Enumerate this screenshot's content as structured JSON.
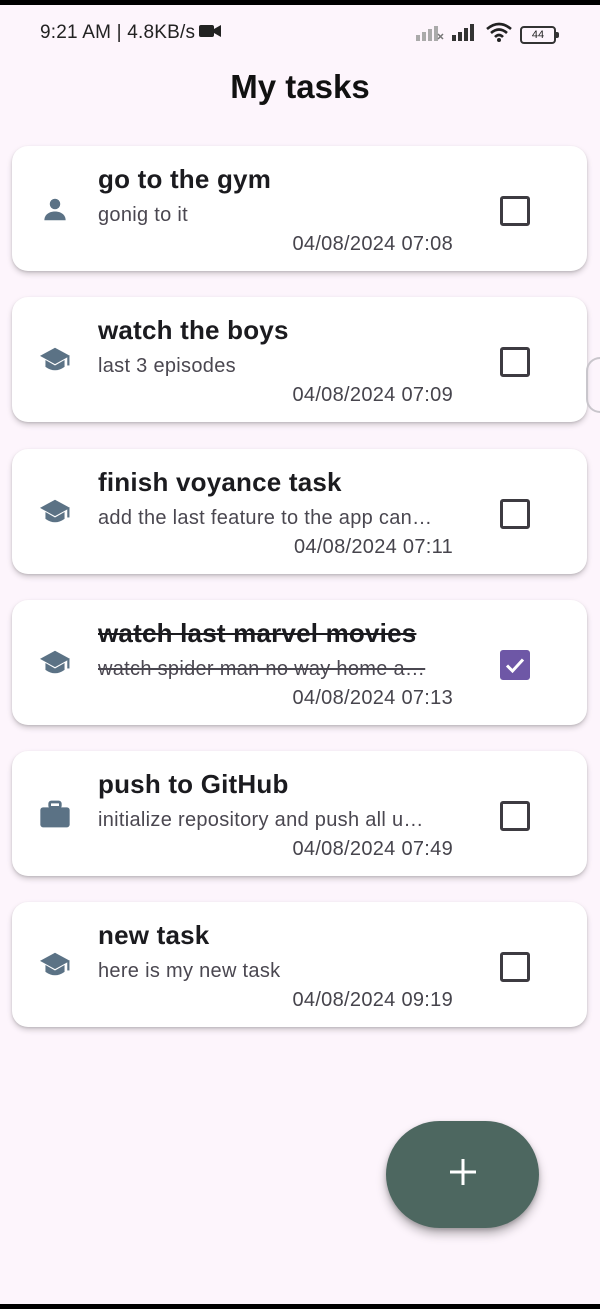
{
  "status_bar": {
    "time_and_speed": "9:21 AM | 4.8KB/s",
    "battery": "44"
  },
  "header": {
    "title": "My tasks"
  },
  "colors": {
    "background": "#fdf5fc",
    "icon": "#5b7285",
    "checkbox_checked": "#6e57a6",
    "fab": "#4d6760"
  },
  "tasks": [
    {
      "title": "go to the gym",
      "description": "gonig to it",
      "date": "04/08/2024 07:08",
      "icon": "person-icon",
      "done": false
    },
    {
      "title": "watch the boys",
      "description": "last 3 episodes",
      "date": "04/08/2024 07:09",
      "icon": "school-icon",
      "done": false
    },
    {
      "title": "finish voyance task",
      "description": "add the last feature to the app can…",
      "date": "04/08/2024 07:11",
      "icon": "school-icon",
      "done": false
    },
    {
      "title": "watch last marvel movies",
      "description": "watch spider man no way home a…",
      "date": "04/08/2024 07:13",
      "icon": "school-icon",
      "done": true
    },
    {
      "title": "push to GitHub",
      "description": "initialize repository and push all u…",
      "date": "04/08/2024 07:49",
      "icon": "briefcase-icon",
      "done": false
    },
    {
      "title": "new task",
      "description": "here is my new task",
      "date": "04/08/2024 09:19",
      "icon": "school-icon",
      "done": false
    }
  ],
  "fab": {
    "icon": "plus-icon"
  }
}
